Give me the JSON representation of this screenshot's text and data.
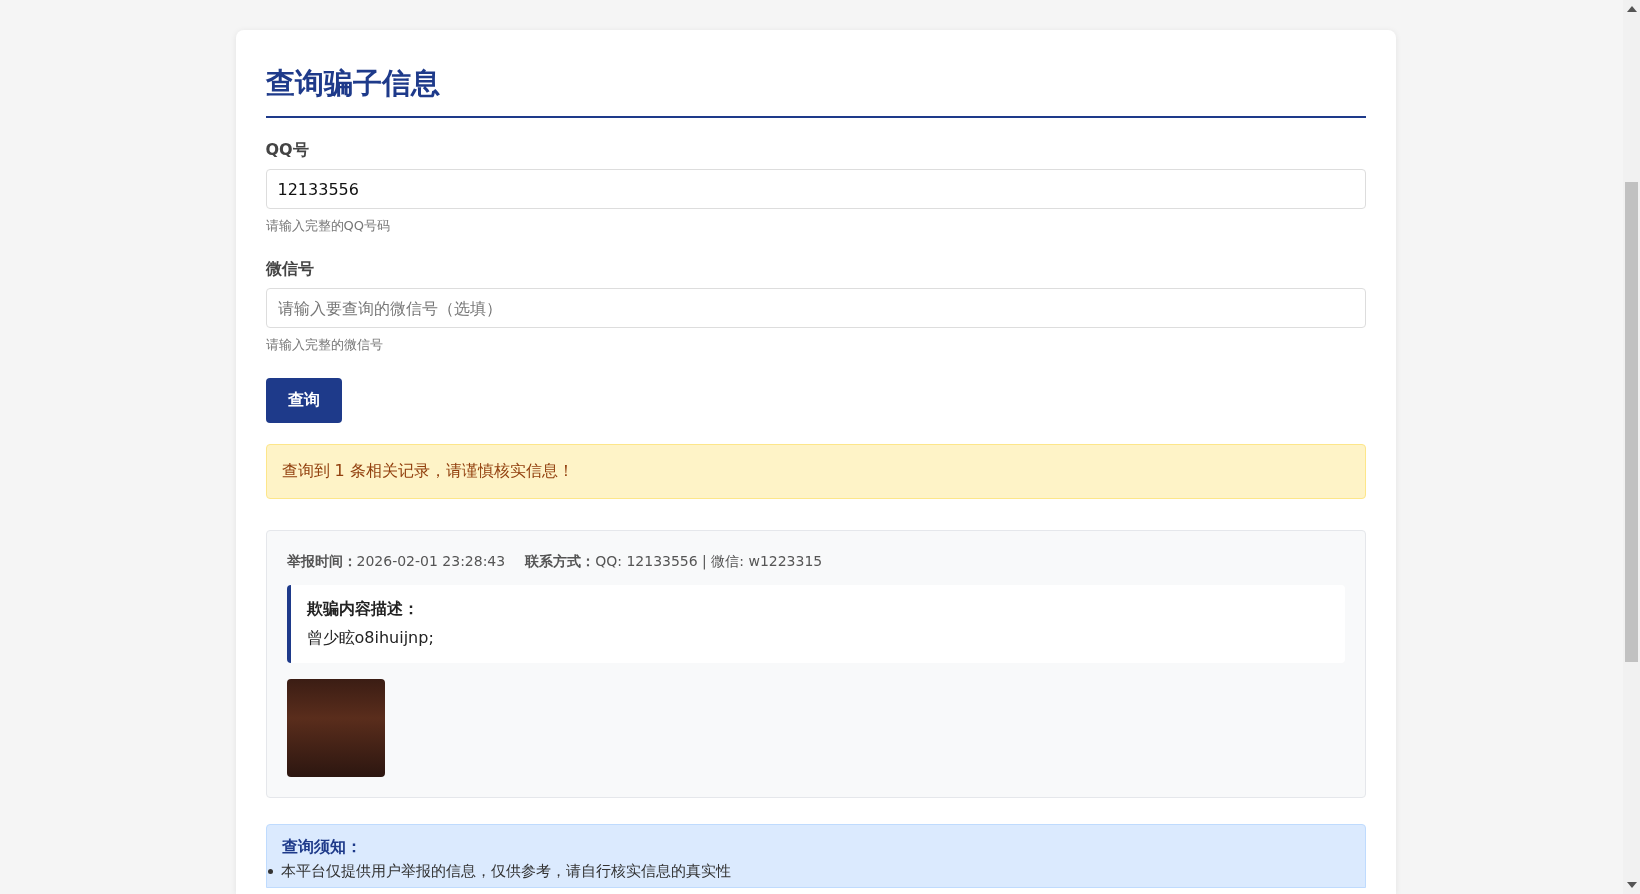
{
  "page": {
    "title": "查询骗子信息"
  },
  "form": {
    "fields": [
      {
        "label": "QQ号",
        "value": "12133556",
        "hint": "请输入完整的QQ号码"
      },
      {
        "label": "微信号",
        "placeholder": "请输入要查询的微信号（选填）",
        "hint": "请输入完整的微信号"
      }
    ],
    "submit": "查询"
  },
  "alert": "查询到 1 条相关记录，请谨慎核实信息！",
  "records": [
    {
      "meta": [
        "**举报时间：**2026-02-01 23:28:43",
        "**联系方式：**QQ: 12133556 | 微信: w1223315"
      ],
      "description_title": "欺骗内容描述：",
      "description": "曾少眩o8ihuijnp;"
    }
  ],
  "notice": {
    "title": "查询须知：",
    "items": [
      "本平台仅提供用户举报的信息，仅供参考，请自行核实信息的真实性"
    ]
  }
}
